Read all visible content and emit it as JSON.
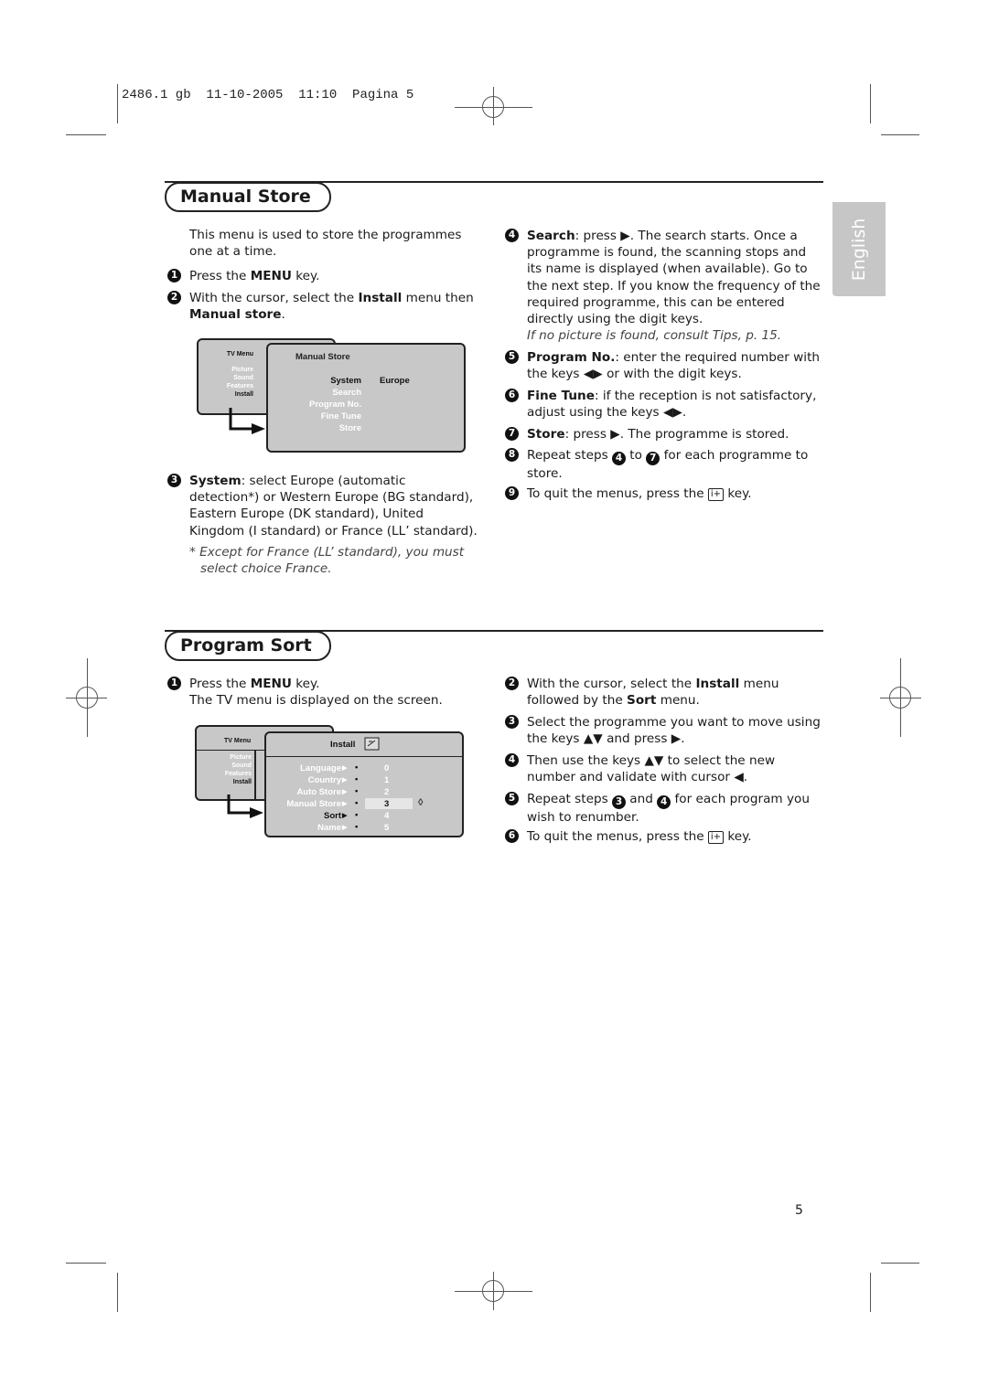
{
  "print_header": "2486.1 gb  11-10-2005  11:10  Pagina 5",
  "language_tab": "English",
  "page_number": "5",
  "manual_store": {
    "title": "Manual Store",
    "intro": "This menu is used to store the programmes one at a time.",
    "steps": [
      {
        "num": "1",
        "pre": "Press the ",
        "bold": "MENU",
        "post": " key."
      },
      {
        "num": "2",
        "pre": "With the cursor, select the ",
        "bold": "Install",
        "mid": " menu then ",
        "bold2": "Manual store",
        "post": "."
      },
      {
        "num": "3",
        "bold": "System",
        "post": ": select Europe (automatic detection*) or Western Europe (BG standard), Eastern Europe (DK standard), United Kingdom (I standard) or France (LL’ standard)."
      },
      {
        "num": "4",
        "bold": "Search",
        "pre": ": press ",
        "post": ". The search starts. Once a programme is found, the scanning stops and its name is displayed (when available). Go to the next step. If you know the frequency of the required programme, this can be entered directly using the digit keys.",
        "note": "If no picture is found, consult Tips, p. 15."
      },
      {
        "num": "5",
        "bold": "Program No.",
        "pre": ": enter the required number with the keys ",
        "post": " or with the digit keys."
      },
      {
        "num": "6",
        "bold": "Fine Tune",
        "pre": ": if the reception is not satisfactory, adjust using the keys ",
        "post": "."
      },
      {
        "num": "7",
        "bold": "Store",
        "pre": ": press ",
        "post": ". The programme is stored."
      },
      {
        "num": "8",
        "pre": "Repeat steps ",
        "ref1": "4",
        "mid": " to ",
        "ref2": "7",
        "post": " for each programme to store."
      },
      {
        "num": "9",
        "pre": "To quit the menus, press the ",
        "key": "i+",
        "post": " key."
      }
    ],
    "footnote": "* Except for France (LL’ standard), you must select choice France.",
    "diagram": {
      "tv_menu": "TV Menu",
      "menu_items": [
        "Picture",
        "Sound",
        "Features",
        "Install"
      ],
      "panel_title": "Manual Store",
      "items": [
        "System",
        "Search",
        "Program No.",
        "Fine Tune",
        "Store"
      ],
      "system_value": "Europe"
    }
  },
  "program_sort": {
    "title": "Program Sort",
    "steps": [
      {
        "num": "1",
        "pre": "Press the ",
        "bold": "MENU",
        "post": " key.",
        "line2": "The TV menu is displayed on the screen."
      },
      {
        "num": "2",
        "pre": "With the cursor, select the ",
        "bold": "Install",
        "mid": " menu followed by the ",
        "bold2": "Sort",
        "post": " menu."
      },
      {
        "num": "3",
        "pre": "Select the programme you want to move using the keys ",
        "mid": " and press ",
        "post": "."
      },
      {
        "num": "4",
        "pre": "Then use the keys ",
        "mid": " to select the new number and validate with cursor ",
        "post": "."
      },
      {
        "num": "5",
        "pre": "Repeat steps ",
        "ref1": "3",
        "mid": " and ",
        "ref2": "4",
        "post": " for each program you wish to renumber."
      },
      {
        "num": "6",
        "pre": "To quit the menus, press the ",
        "key": "i+",
        "post": " key."
      }
    ],
    "diagram": {
      "tv_menu": "TV Menu",
      "menu_items": [
        "Picture",
        "Sound",
        "Features",
        "Install"
      ],
      "panel_title": "Install",
      "items": [
        "Language",
        "Country",
        "Auto Store",
        "Manual Store",
        "Sort",
        "Name"
      ],
      "numbers": [
        "0",
        "1",
        "2",
        "3",
        "4",
        "5"
      ],
      "selected_number": "3"
    }
  }
}
